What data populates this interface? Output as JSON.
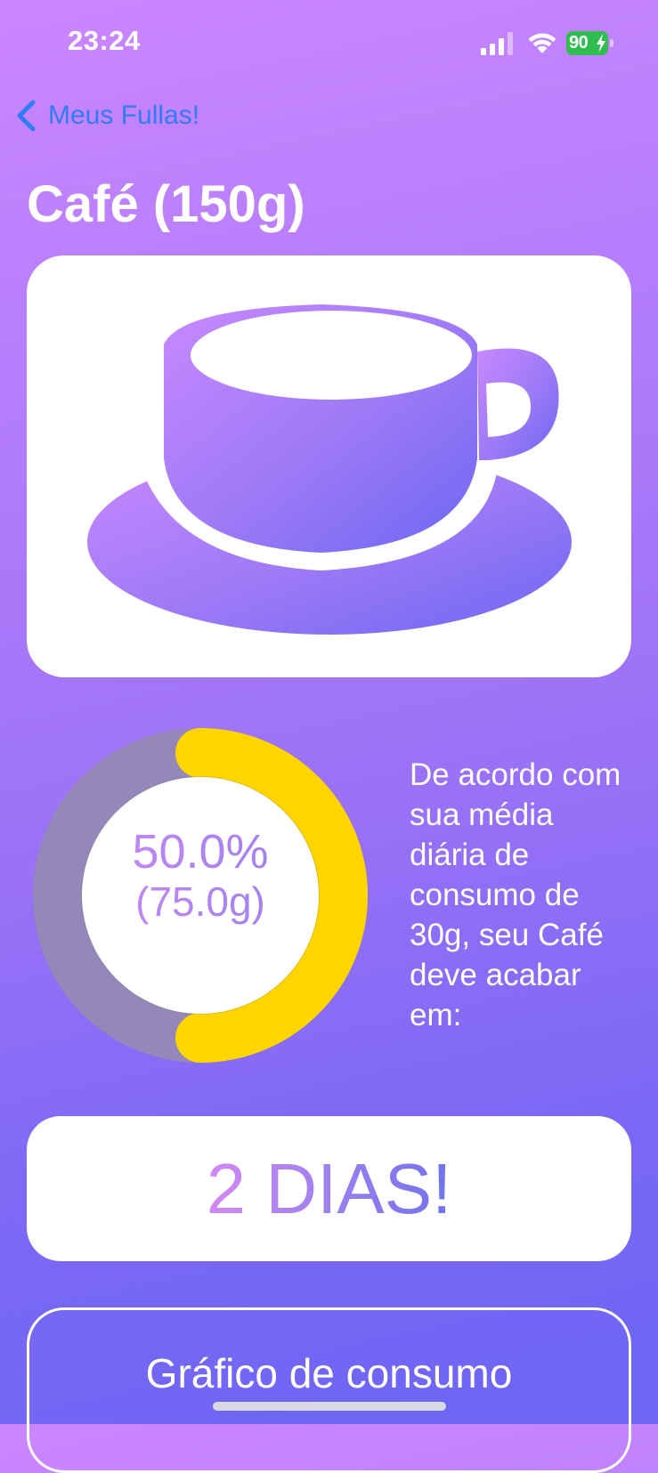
{
  "status_bar": {
    "time": "23:24",
    "battery": "90"
  },
  "nav": {
    "back_label": "Meus Fullas!"
  },
  "product": {
    "title": "Café (150g)",
    "icon": "coffee-cup-icon"
  },
  "progress": {
    "percent_label": "50.0%",
    "grams_label": "(75.0g)",
    "fraction": 0.5,
    "fill_color": "#ffd500",
    "track_color": "#9488b8"
  },
  "forecast": {
    "text": "De acordo com sua média diária de consumo de 30g, seu Café deve acabar em:"
  },
  "result": {
    "days": "2 DIAS!"
  },
  "chart_section": {
    "title": "Gráfico de consumo"
  },
  "colors": {
    "accent_blue": "#2f7cf6",
    "battery_green": "#2fbd4f",
    "gradient_top": "#cb86ff",
    "gradient_bottom": "#6c66f3"
  }
}
